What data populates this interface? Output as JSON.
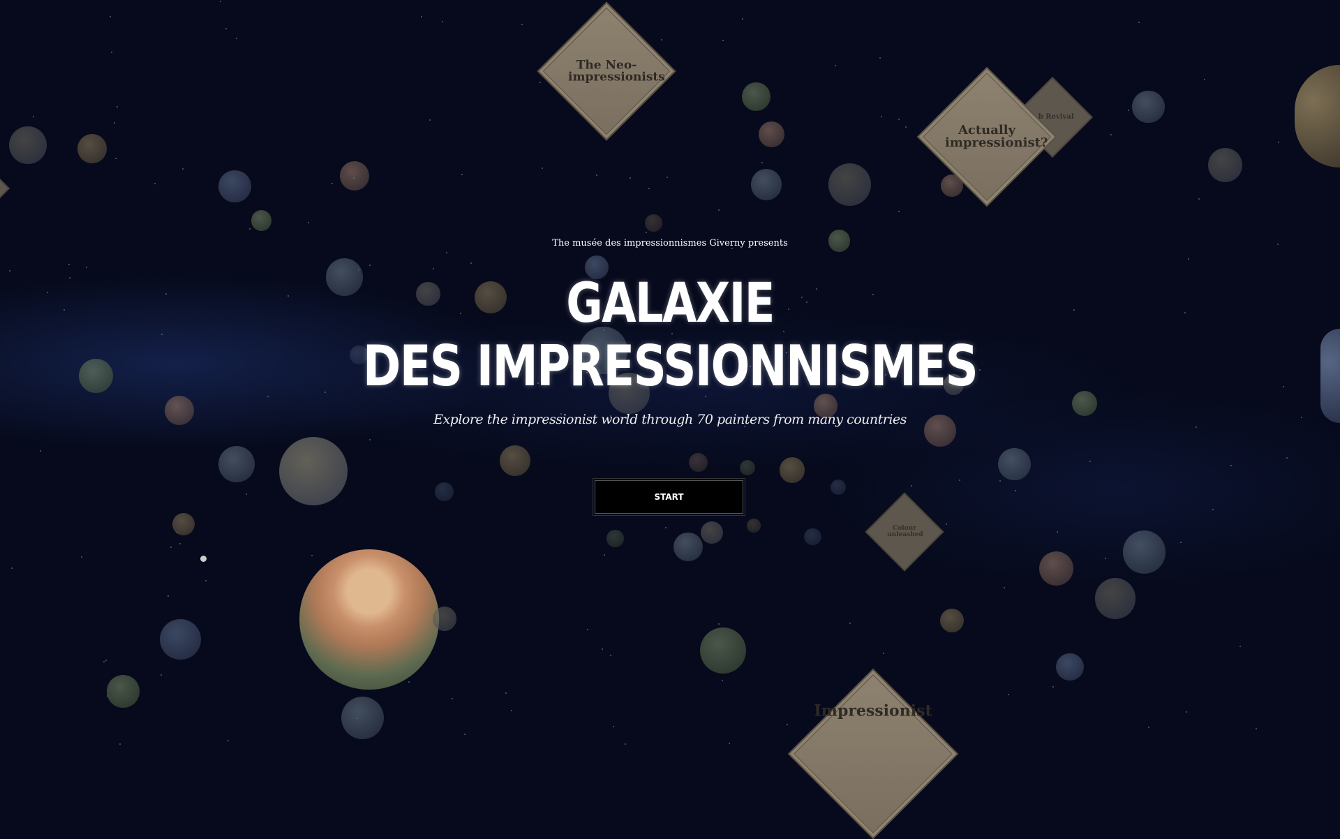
{
  "intro": {
    "presents": "The musée des impressionnismes Giverny presents",
    "title_line1": "GALAXIE",
    "title_line2": "DES IMPRESSIONNISMES",
    "subtitle": "Explore the impressionist world through 70 painters from many countries",
    "start_label": "START"
  },
  "themes": [
    {
      "label": "The Neo-impressionists"
    },
    {
      "label": "Actually impressionist?"
    },
    {
      "label": "...b Revival"
    },
    {
      "label": "Colour unleashed"
    },
    {
      "label": "Impressionist"
    }
  ],
  "colors": {
    "background": "#060a1c",
    "diamond": "#8e8270",
    "text": "#ffffff"
  }
}
